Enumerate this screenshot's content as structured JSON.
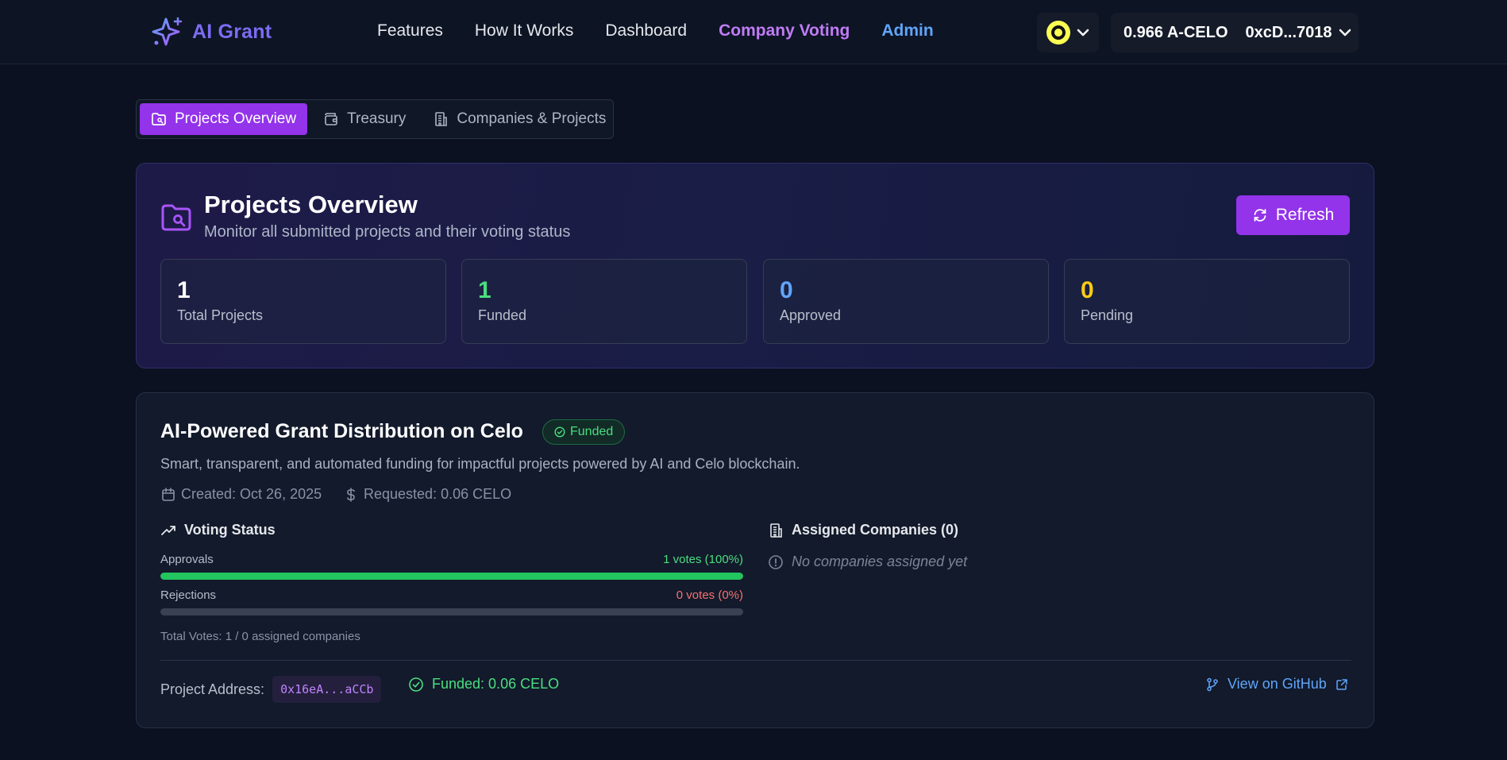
{
  "header": {
    "brand": "AI Grant",
    "nav": [
      "Features",
      "How It Works",
      "Dashboard",
      "Company Voting",
      "Admin"
    ],
    "balance": "0.966 A-CELO",
    "address": "0xcD...7018",
    "chain_icon": "celo-logo-icon"
  },
  "tabs": [
    {
      "label": "Projects Overview",
      "icon": "folder-icon",
      "active": true
    },
    {
      "label": "Treasury",
      "icon": "wallet-icon",
      "active": false
    },
    {
      "label": "Companies & Projects",
      "icon": "building-icon",
      "active": false
    }
  ],
  "overview": {
    "title": "Projects Overview",
    "subtitle": "Monitor all submitted projects and their voting status",
    "refresh_label": "Refresh",
    "stats": [
      {
        "value": "1",
        "label": "Total Projects",
        "color": "#ffffff"
      },
      {
        "value": "1",
        "label": "Funded",
        "color": "#4ade80"
      },
      {
        "value": "0",
        "label": "Approved",
        "color": "#60a5fa"
      },
      {
        "value": "0",
        "label": "Pending",
        "color": "#facc15"
      }
    ]
  },
  "project": {
    "title": "AI-Powered Grant Distribution on Celo",
    "status": "Funded",
    "description": "Smart, transparent, and automated funding for impactful projects powered by AI and Celo blockchain.",
    "created": "Created: Oct 26, 2025",
    "requested": "Requested: 0.06 CELO",
    "voting_heading": "Voting Status",
    "approvals_label": "Approvals",
    "approvals_value": "1 votes (100%)",
    "approvals_fraction": 1.0,
    "rejections_label": "Rejections",
    "rejections_value": "0 votes (0%)",
    "rejections_fraction": 0.0,
    "total_votes": "Total Votes: 1 / 0 assigned companies",
    "companies_heading": "Assigned Companies (0)",
    "companies_empty": "No companies assigned yet",
    "address_label": "Project Address:",
    "address": "0x16eA...aCCb",
    "funded_note": "Funded: 0.06 CELO",
    "github_label": "View on GitHub"
  },
  "colors": {
    "accent": "#9333ea",
    "success": "#22c55e",
    "danger": "#f87171",
    "link": "#60a5fa"
  }
}
